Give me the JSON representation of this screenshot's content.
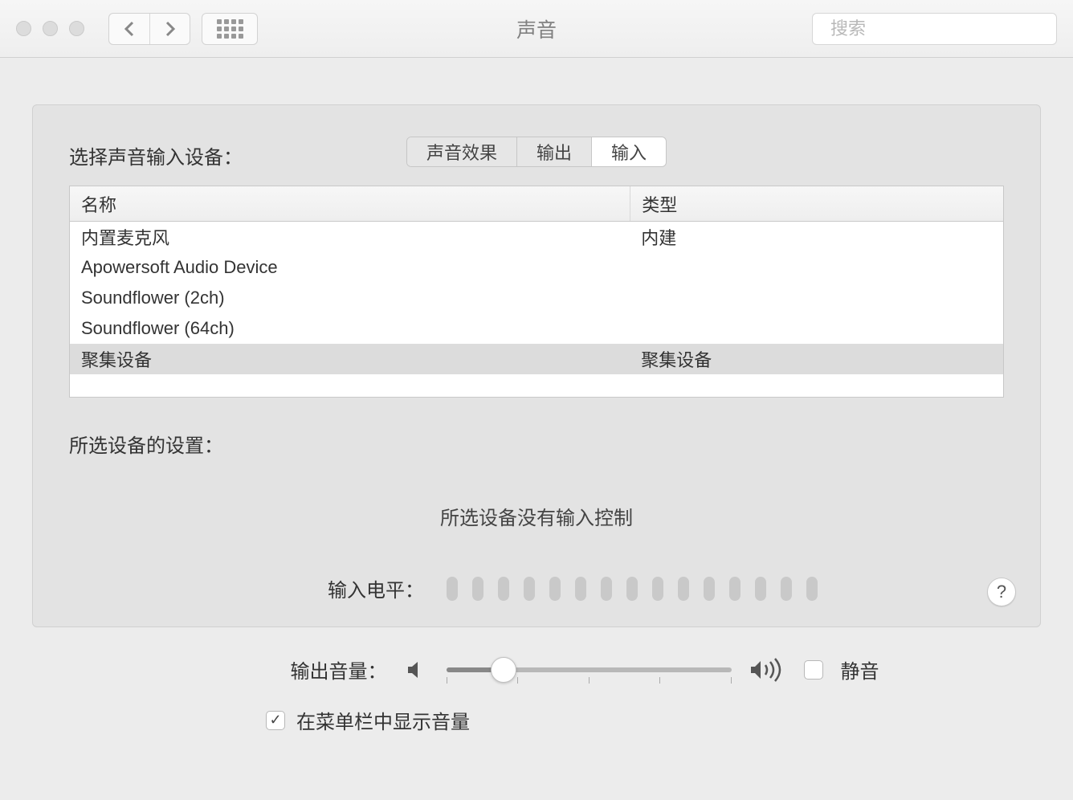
{
  "window": {
    "title": "声音",
    "search_placeholder": "搜索"
  },
  "tabs": [
    {
      "label": "声音效果",
      "active": false
    },
    {
      "label": "输出",
      "active": false
    },
    {
      "label": "输入",
      "active": true
    }
  ],
  "device_section": {
    "heading": "选择声音输入设备：",
    "columns": {
      "name": "名称",
      "type": "类型"
    },
    "rows": [
      {
        "name": "内置麦克风",
        "type": "内建",
        "selected": false
      },
      {
        "name": "Apowersoft Audio Device",
        "type": "",
        "selected": false
      },
      {
        "name": "Soundflower (2ch)",
        "type": "",
        "selected": false
      },
      {
        "name": "Soundflower (64ch)",
        "type": "",
        "selected": false
      },
      {
        "name": "聚集设备",
        "type": "聚集设备",
        "selected": true
      }
    ]
  },
  "settings": {
    "heading": "所选设备的设置：",
    "no_controls": "所选设备没有输入控制",
    "input_level_label": "输入电平：",
    "level_segments": 15
  },
  "help_label": "?",
  "footer": {
    "output_label": "输出音量：",
    "volume_percent": 20,
    "mute_label": "静音",
    "mute_checked": false,
    "menubar_label": "在菜单栏中显示音量",
    "menubar_checked": true
  }
}
